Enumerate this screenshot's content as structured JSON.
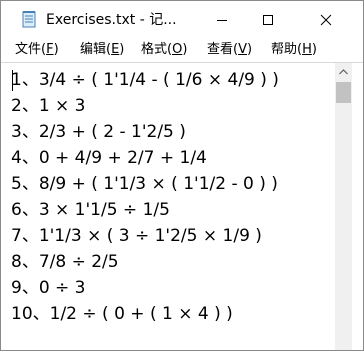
{
  "window": {
    "title": "Exercises.txt - 记..."
  },
  "menu": [
    {
      "label": "文件(",
      "accel": "F",
      "close": ")"
    },
    {
      "label": "编辑(",
      "accel": "E",
      "close": ")"
    },
    {
      "label": "格式(",
      "accel": "O",
      "close": ")"
    },
    {
      "label": "查看(",
      "accel": "V",
      "close": ")"
    },
    {
      "label": "帮助(",
      "accel": "H",
      "close": ")"
    }
  ],
  "editor": {
    "lines": [
      "1、3/4 ÷ ( 1'1/4 - ( 1/6 × 4/9 ) )",
      "2、1 × 3",
      "3、2/3 + ( 2 - 1'2/5 )",
      "4、0 + 4/9 + 2/7 + 1/4",
      "5、8/9 + ( 1'1/3 × ( 1'1/2 - 0 ) )",
      "6、3 × 1'1/5 ÷ 1/5",
      "7、1'1/3 × ( 3 ÷ 1'2/5 × 1/9 )",
      "8、7/8 ÷ 2/5",
      "9、0 ÷ 3",
      "10、1/2 ÷ ( 0 + ( 1 × 4 ) )"
    ]
  }
}
